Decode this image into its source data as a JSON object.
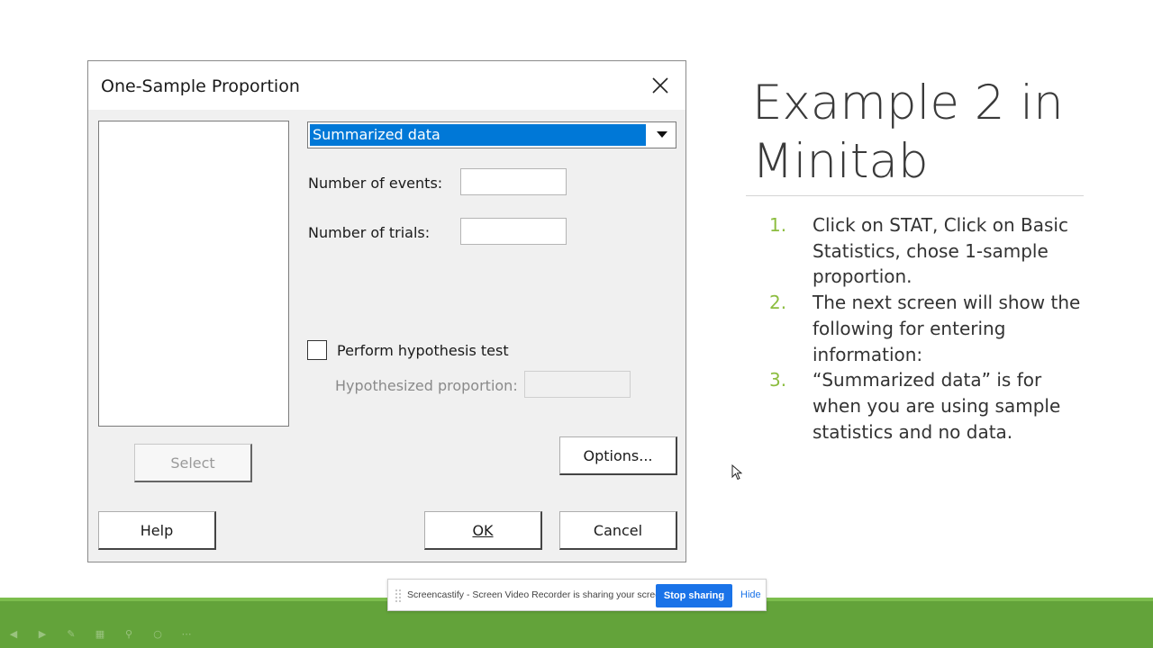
{
  "dialog": {
    "title": "One-Sample Proportion",
    "data_select": {
      "selected": "Summarized data"
    },
    "fields": {
      "events_label": "Number of events:",
      "trials_label": "Number of trials:"
    },
    "hypothesis": {
      "checkbox_label": "Perform hypothesis test",
      "checked": false,
      "proportion_label": "Hypothesized proportion:"
    },
    "buttons": {
      "select": "Select",
      "options": "Options...",
      "help": "Help",
      "ok": "OK",
      "cancel": "Cancel"
    }
  },
  "slide": {
    "title_line1": "Example 2 in",
    "title_line2": "Minitab",
    "steps": [
      {
        "num": "1.",
        "text": "Click on STAT, Click on Basic Statistics, chose 1-sample proportion."
      },
      {
        "num": "2.",
        "text": "The next screen will show the following for entering information:"
      },
      {
        "num": "3.",
        "text": "“Summarized data” is for when you are using sample statistics and no data."
      }
    ],
    "accent_color": "#63a33a",
    "number_color": "#8cbd3f"
  },
  "share_bar": {
    "message": "Screencastify - Screen Video Recorder is sharing your screen.",
    "stop_label": "Stop sharing",
    "hide_label": "Hide"
  },
  "slideshow_nav": {
    "icons": [
      "prev-icon",
      "next-icon",
      "pen-icon",
      "slides-icon",
      "zoom-icon",
      "circle-icon",
      "more-icon"
    ]
  }
}
